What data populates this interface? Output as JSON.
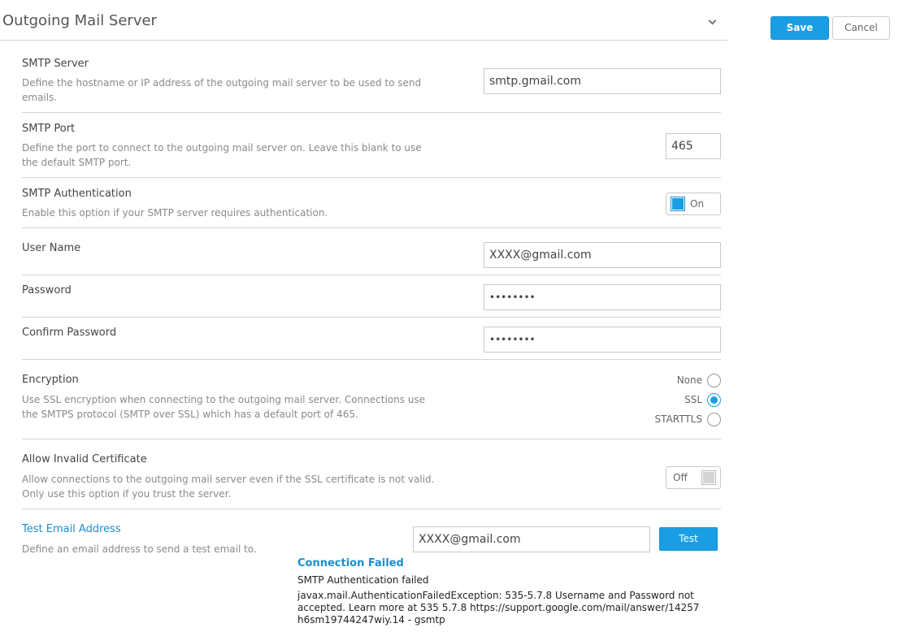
{
  "header": {
    "title": "Outgoing Mail Server",
    "save_label": "Save",
    "cancel_label": "Cancel"
  },
  "smtp_server": {
    "label": "SMTP Server",
    "description": "Define the hostname or IP address of the outgoing mail server to be used to send emails.",
    "value": "smtp.gmail.com"
  },
  "smtp_port": {
    "label": "SMTP Port",
    "description": "Define the port to connect to the outgoing mail server on. Leave this blank to use the default SMTP port.",
    "value": "465"
  },
  "smtp_auth": {
    "label": "SMTP Authentication",
    "description": "Enable this option if your SMTP server requires authentication.",
    "toggle_label": "On"
  },
  "user_name": {
    "label": "User Name",
    "value": "XXXX@gmail.com"
  },
  "password": {
    "label": "Password",
    "value": "••••••••"
  },
  "confirm_password": {
    "label": "Confirm Password",
    "value": "••••••••"
  },
  "encryption": {
    "label": "Encryption",
    "description": "Use SSL encryption when connecting to the outgoing mail server. Connections use the SMTPS protocol (SMTP over SSL) which has a default port of 465.",
    "options": [
      "None",
      "SSL",
      "STARTTLS"
    ],
    "selected": "SSL"
  },
  "invalid_cert": {
    "label": "Allow Invalid Certificate",
    "description": "Allow connections to the outgoing mail server even if the SSL certificate is not valid. Only use this option if you trust the server.",
    "toggle_label": "Off"
  },
  "test_email": {
    "label": "Test Email Address",
    "description": "Define an email address to send a test email to.",
    "value": "XXXX@gmail.com",
    "button_label": "Test"
  },
  "result": {
    "title": "Connection Failed",
    "message": "SMTP Authentication failed",
    "detail": "javax.mail.AuthenticationFailedException: 535-5.7.8 Username and Password not accepted. Learn more at 535 5.7.8 https://support.google.com/mail/answer/14257 h6sm19744247wiy.14 - gsmtp"
  },
  "colors": {
    "accent": "#1a9ee3",
    "link": "#1a8fcf",
    "divider": "#d4d4d4"
  }
}
